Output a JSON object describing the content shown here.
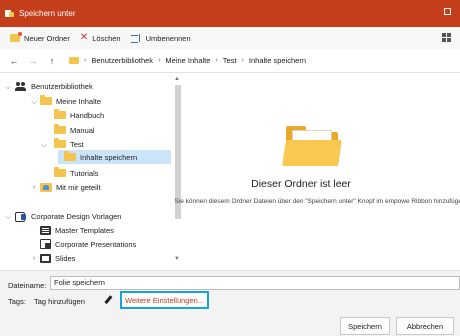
{
  "window": {
    "title": "Speichern unter"
  },
  "toolbar": {
    "new_folder": "Neuer Ordner",
    "delete": "Löschen",
    "rename": "Umbenennen"
  },
  "addressbar": {
    "back_icon": "←",
    "forward_icon": "→",
    "up_icon": "↑",
    "breadcrumbs": [
      "Benutzerbibliothek",
      "Meine Inhalte",
      "Test",
      "Inhalte speichern"
    ]
  },
  "sidebar": {
    "items": [
      {
        "label": "Benutzerbibliothek"
      },
      {
        "label": "Meine Inhalte"
      },
      {
        "label": "Handbuch"
      },
      {
        "label": "Manual"
      },
      {
        "label": "Test"
      },
      {
        "label": "Inhalte speichern"
      },
      {
        "label": "Tutorials"
      },
      {
        "label": "Mit mir geteilt"
      },
      {
        "label": "Corporate Design Vorlagen"
      },
      {
        "label": "Master Templates"
      },
      {
        "label": "Corporate Presentations"
      },
      {
        "label": "Slides"
      }
    ]
  },
  "content": {
    "empty_title": "Dieser Ordner ist leer",
    "empty_desc": "Sie können diesem Ordner Dateien über den \"Speichern unter\" Knopf im empowe Ribbon hinzufügen"
  },
  "footer": {
    "filename_label": "Dateiname:",
    "filename_value": "Folie speichern",
    "tags_label": "Tags:",
    "tags_add": "Tag hinzufügen",
    "more_settings": "Weitere Einstellungen...",
    "save": "Speichern",
    "cancel": "Abbrechen"
  },
  "colors": {
    "titlebar": "#c43e1c",
    "folder": "#f4c44e",
    "selection": "#cce4f7",
    "highlight_border": "#1aa3d9"
  }
}
